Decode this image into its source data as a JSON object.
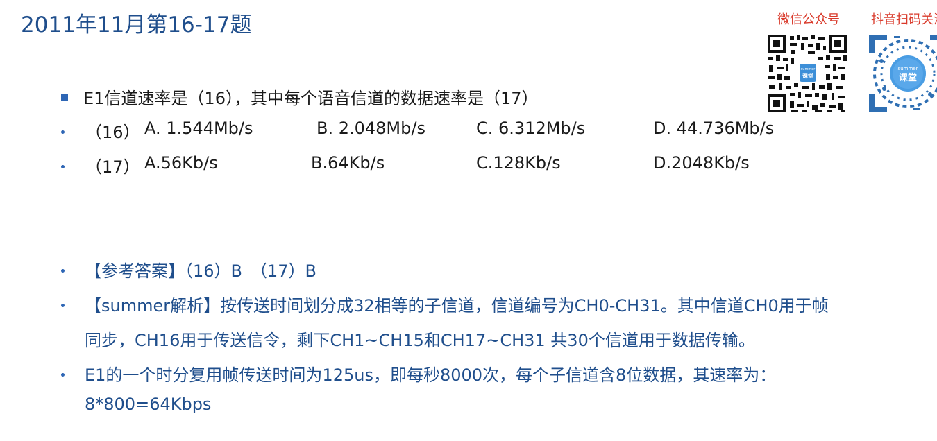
{
  "title": "2011年11月第16-17题",
  "qr": {
    "wechat_label": "微信公众号",
    "douyin_label": "抖音扫码关注",
    "center_logo_top": "summer",
    "center_logo_bottom": "课堂"
  },
  "question": {
    "stem": "E1信道速率是（16），其中每个语音信道的数据速率是（17）",
    "q16": {
      "num": "（16）",
      "a": "A. 1.544Mb/s",
      "b": "B. 2.048Mb/s",
      "c": "C. 6.312Mb/s",
      "d": "D. 44.736Mb/s"
    },
    "q17": {
      "num": "（17）",
      "a": "A.56Kb/s",
      "b": "B.64Kb/s",
      "c": "C.128Kb/s",
      "d": "D.2048Kb/s"
    }
  },
  "answer": {
    "ref": "【参考答案】（16）B　（17）B",
    "analysis_line1": "【summer解析】按传送时间划分成32相等的子信道，信道编号为CH0-CH31。其中信道CH0用于帧",
    "analysis_line2": "同步，CH16用于传送信令，剩下CH1~CH15和CH17~CH31 共30个信道用于数据传输。",
    "calc_line1": "E1的一个时分复用帧传送时间为125us，即每秒8000次，每个子信道含8位数据，其速率为：",
    "calc_line2": "8*800=64Kbps"
  },
  "colors": {
    "title": "#1f4e8c",
    "bullet": "#2e66b5",
    "qr_label": "#d93a2b"
  }
}
